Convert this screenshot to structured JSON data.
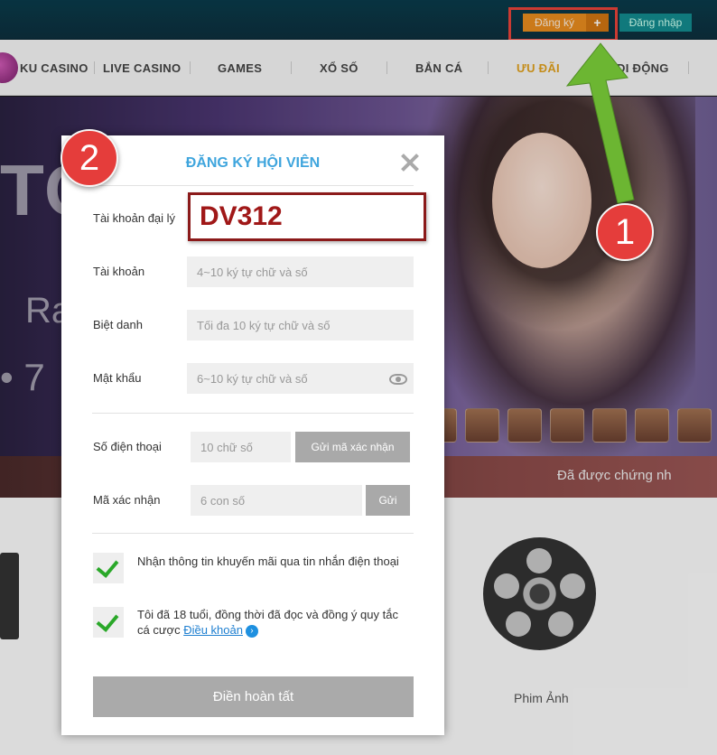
{
  "topbar": {
    "register_label": "Đăng ký",
    "register_plus": "+",
    "login_label": "Đăng nhập"
  },
  "nav": {
    "items": [
      {
        "label": "KU CASINO"
      },
      {
        "label": "LIVE CASINO"
      },
      {
        "label": "GAMES"
      },
      {
        "label": "XỔ SỐ"
      },
      {
        "label": "BẮN CÁ"
      },
      {
        "label": "ƯU ĐÃI"
      },
      {
        "label": "DI ĐỘNG"
      }
    ],
    "active_color": "#e0a01d"
  },
  "banner": {
    "text_left_top": "TC",
    "text_left_mid": "Ra",
    "text_left_low": "• 7"
  },
  "strip": {
    "text": "Đã được chứng nh"
  },
  "lower": {
    "film_label": "Phim Ảnh"
  },
  "annotations": {
    "step1": "1",
    "step2": "2",
    "arrow_color": "#6cb632",
    "badge_color": "#e53d3b"
  },
  "modal": {
    "title": "ĐĂNG KÝ HỘI VIÊN",
    "agent_label": "Tài khoản đại lý",
    "agent_value": "DV312",
    "account_label": "Tài khoản",
    "account_placeholder": "4~10 ký tự chữ và số",
    "nickname_label": "Biệt danh",
    "nickname_placeholder": "Tối đa 10 ký tự chữ và số",
    "password_label": "Mật khẩu",
    "password_placeholder": "6~10 ký tự chữ và số",
    "phone_label": "Số điện thoại",
    "phone_placeholder": "10 chữ số",
    "send_code_label": "Gửi mã xác nhận",
    "code_label": "Mã xác nhận",
    "code_placeholder": "6 con số",
    "send_label": "Gửi",
    "promo_check_text": "Nhận thông tin khuyến mãi qua tin nhắn điện thoại",
    "terms_text": "Tôi đã 18 tuổi, đồng thời đã đọc và đồng ý quy tắc cá cược ",
    "terms_link": "Điều khoản",
    "info_glyph": "›",
    "submit_label": "Điền hoàn tất",
    "title_color": "#3fa5dd"
  }
}
